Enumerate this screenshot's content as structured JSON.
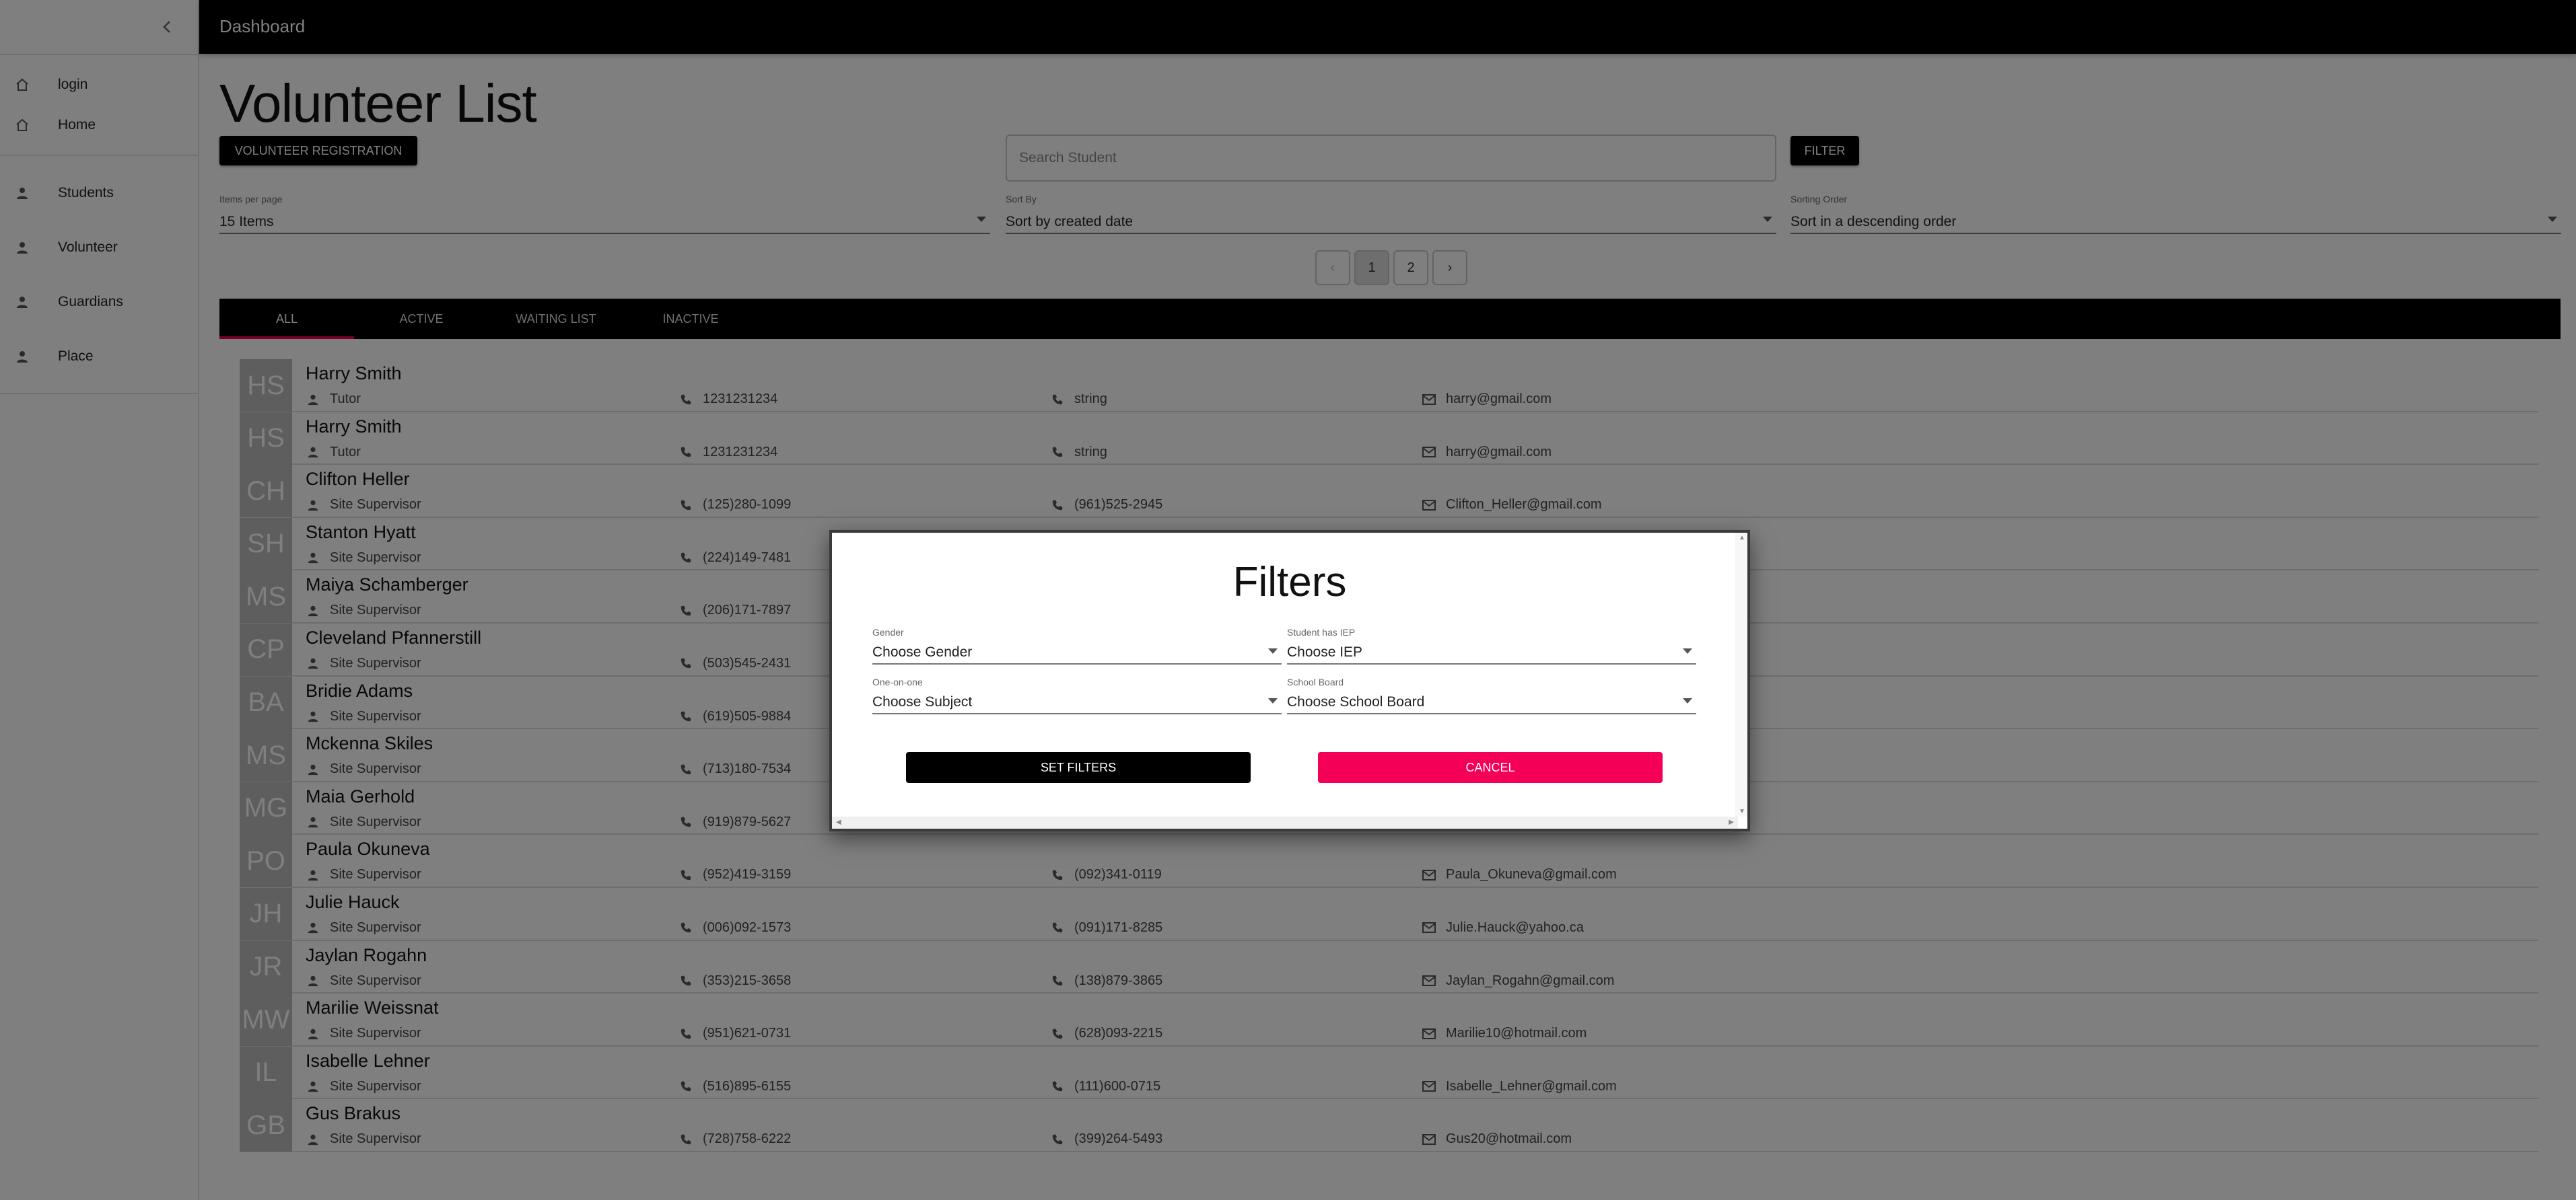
{
  "appbar": {
    "title": "Dashboard"
  },
  "sidebar": {
    "items": [
      {
        "label": "login",
        "icon": "home-icon"
      },
      {
        "label": "Home",
        "icon": "home-icon"
      },
      {
        "label": "Students",
        "icon": "person-icon"
      },
      {
        "label": "Volunteer",
        "icon": "person-icon"
      },
      {
        "label": "Guardians",
        "icon": "person-icon"
      },
      {
        "label": "Place",
        "icon": "person-icon"
      }
    ]
  },
  "main": {
    "title": "Volunteer List",
    "registration_button": "VOLUNTEER REGISTRATION",
    "search_placeholder": "Search Student",
    "filter_button": "FILTER",
    "items_per_page": {
      "label": "Items per page",
      "value": "15 Items"
    },
    "sort_by": {
      "label": "Sort By",
      "value": "Sort by created date"
    },
    "sorting_order": {
      "label": "Sorting Order",
      "value": "Sort in a descending order"
    },
    "pagination": {
      "prev": "‹",
      "pages": [
        "1",
        "2"
      ],
      "next": "›",
      "current": "1"
    },
    "tabs": [
      "ALL",
      "ACTIVE",
      "WAITING LIST",
      "INACTIVE"
    ],
    "active_tab": "ALL",
    "volunteers": [
      {
        "initials": "HS",
        "name": "Harry Smith",
        "role": "Tutor",
        "phone1": "1231231234",
        "phone2": "string",
        "email": "harry@gmail.com"
      },
      {
        "initials": "HS",
        "name": "Harry Smith",
        "role": "Tutor",
        "phone1": "1231231234",
        "phone2": "string",
        "email": "harry@gmail.com"
      },
      {
        "initials": "CH",
        "name": "Clifton Heller",
        "role": "Site Supervisor",
        "phone1": "(125)280-1099",
        "phone2": "(961)525-2945",
        "email": "Clifton_Heller@gmail.com"
      },
      {
        "initials": "SH",
        "name": "Stanton Hyatt",
        "role": "Site Supervisor",
        "phone1": "(224)149-7481",
        "phone2": "",
        "email": ""
      },
      {
        "initials": "MS",
        "name": "Maiya Schamberger",
        "role": "Site Supervisor",
        "phone1": "(206)171-7897",
        "phone2": "",
        "email": ""
      },
      {
        "initials": "CP",
        "name": "Cleveland Pfannerstill",
        "role": "Site Supervisor",
        "phone1": "(503)545-2431",
        "phone2": "",
        "email": ""
      },
      {
        "initials": "BA",
        "name": "Bridie Adams",
        "role": "Site Supervisor",
        "phone1": "(619)505-9884",
        "phone2": "",
        "email": ""
      },
      {
        "initials": "MS",
        "name": "Mckenna Skiles",
        "role": "Site Supervisor",
        "phone1": "(713)180-7534",
        "phone2": "",
        "email": ""
      },
      {
        "initials": "MG",
        "name": "Maia Gerhold",
        "role": "Site Supervisor",
        "phone1": "(919)879-5627",
        "phone2": "",
        "email": ""
      },
      {
        "initials": "PO",
        "name": "Paula Okuneva",
        "role": "Site Supervisor",
        "phone1": "(952)419-3159",
        "phone2": "(092)341-0119",
        "email": "Paula_Okuneva@gmail.com"
      },
      {
        "initials": "JH",
        "name": "Julie Hauck",
        "role": "Site Supervisor",
        "phone1": "(006)092-1573",
        "phone2": "(091)171-8285",
        "email": "Julie.Hauck@yahoo.ca"
      },
      {
        "initials": "JR",
        "name": "Jaylan Rogahn",
        "role": "Site Supervisor",
        "phone1": "(353)215-3658",
        "phone2": "(138)879-3865",
        "email": "Jaylan_Rogahn@gmail.com"
      },
      {
        "initials": "MW",
        "name": "Marilie Weissnat",
        "role": "Site Supervisor",
        "phone1": "(951)621-0731",
        "phone2": "(628)093-2215",
        "email": "Marilie10@hotmail.com"
      },
      {
        "initials": "IL",
        "name": "Isabelle Lehner",
        "role": "Site Supervisor",
        "phone1": "(516)895-6155",
        "phone2": "(111)600-0715",
        "email": "Isabelle_Lehner@gmail.com"
      },
      {
        "initials": "GB",
        "name": "Gus Brakus",
        "role": "Site Supervisor",
        "phone1": "(728)758-6222",
        "phone2": "(399)264-5493",
        "email": "Gus20@hotmail.com"
      }
    ]
  },
  "dialog": {
    "title": "Filters",
    "gender": {
      "label": "Gender",
      "value": "Choose Gender"
    },
    "iep": {
      "label": "Student has IEP",
      "value": "Choose IEP"
    },
    "one_on_one": {
      "label": "One-on-one",
      "value": "Choose Subject"
    },
    "school_board": {
      "label": "School Board",
      "value": "Choose School Board"
    },
    "set_button": "SET FILTERS",
    "cancel_button": "CANCEL"
  },
  "colors": {
    "accent": "#f50057",
    "appbar": "#000000",
    "overlay": "rgba(0,0,0,0.5)"
  }
}
